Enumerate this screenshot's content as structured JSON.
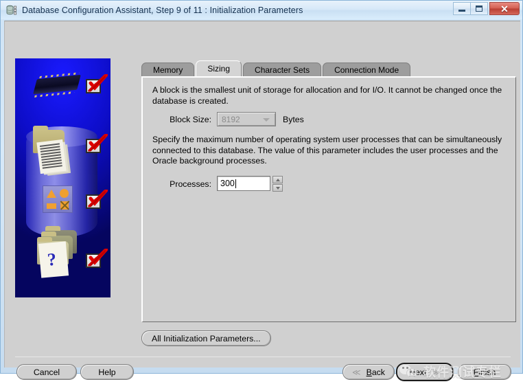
{
  "window": {
    "title": "Database Configuration Assistant, Step 9 of 11 : Initialization Parameters",
    "icon": "database-icon",
    "controls": {
      "minimize": "minimize-icon",
      "maximize": "restore-icon",
      "close": "✕"
    }
  },
  "tabs": [
    {
      "label": "Memory",
      "active": false
    },
    {
      "label": "Sizing",
      "active": true
    },
    {
      "label": "Character Sets",
      "active": false
    },
    {
      "label": "Connection Mode",
      "active": false
    }
  ],
  "panel": {
    "paragraph1": "A block is the smallest unit of storage for allocation and for I/O. It cannot be changed once the database is created.",
    "block_size": {
      "label": "Block Size:",
      "value": "8192",
      "unit": "Bytes",
      "disabled": true
    },
    "paragraph2": "Specify the maximum number of operating system user processes that can be simultaneously connected to this database. The value of this parameter includes the user processes and the Oracle background processes.",
    "processes": {
      "label": "Processes:",
      "value": "300"
    }
  },
  "buttons": {
    "all_parameters": "All Initialization Parameters...",
    "cancel": "Cancel",
    "help": "Help",
    "back": "Back",
    "back_mnemonic": "B",
    "next": "Next",
    "next_mnemonic": "N",
    "finish": "Finish",
    "finish_mnemonic": "F"
  },
  "watermark": {
    "text": "软件测试专栏",
    "logo": "wechat-icon"
  },
  "sidebar": {
    "illustration": "oracle-database-creation-illustration",
    "checks": 4
  },
  "colors": {
    "window_frame": "#cfe3f5",
    "client_bg": "#d0d0d0",
    "tab_inactive": "#9d9d9d",
    "tab_active": "#d4d4d4",
    "sidebar_blue": "#0d0dc8",
    "check_red": "#e00000",
    "close_red": "#c1443a"
  }
}
